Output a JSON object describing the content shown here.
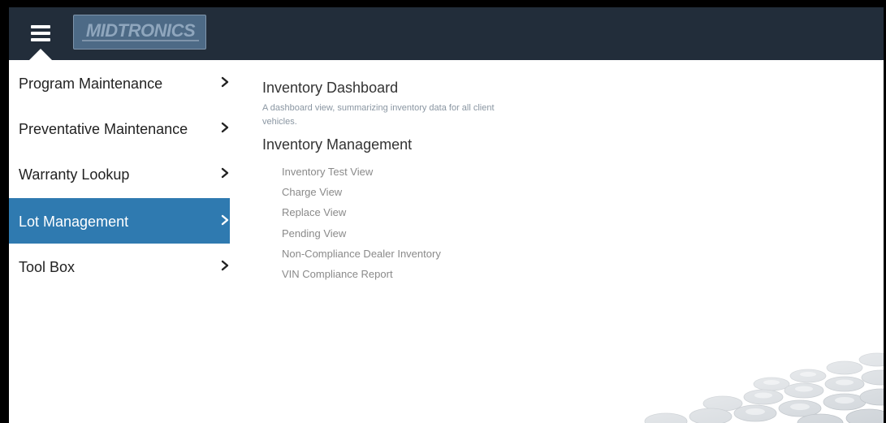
{
  "header": {
    "logo_text": "MIDTRONICS",
    "colors": {
      "bar": "#222d3a",
      "logo_bg": "#4d6a86"
    }
  },
  "sidebar": {
    "items": [
      {
        "label": "Program Maintenance",
        "active": false
      },
      {
        "label": "Preventative Maintenance",
        "active": false
      },
      {
        "label": "Warranty Lookup",
        "active": false
      },
      {
        "label": "Lot Management",
        "active": true
      },
      {
        "label": "Tool Box",
        "active": false
      }
    ],
    "active_color": "#2f7ab0"
  },
  "main": {
    "dashboard_title": "Inventory Dashboard",
    "dashboard_description": "A dashboard view, summarizing inventory data for all client vehicles.",
    "management_title": "Inventory Management",
    "management_links": [
      "Inventory Test View",
      "Charge View",
      "Replace View",
      "Pending View",
      "Non-Compliance Dealer Inventory",
      "VIN Compliance Report"
    ]
  }
}
